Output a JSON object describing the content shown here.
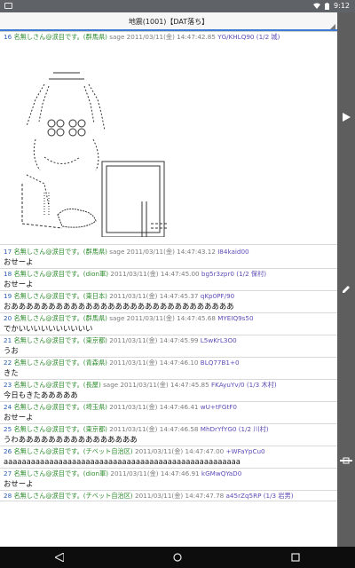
{
  "statusbar": {
    "time": "9:12"
  },
  "thread": {
    "title": "地震(1001)【DAT落ち】"
  },
  "side": {
    "next_icon": "play-arrow-icon",
    "edit_icon": "pencil-icon",
    "scroll_icon": "scroll-handle-icon"
  },
  "posts": [
    {
      "num": "16",
      "name": "名無しさん@涙目です。",
      "pref": "(群馬県)",
      "rest": " sage 2011/03/11(金) 14:47:42.85 ",
      "id": "YG/KHLQ90 (1/2 城)",
      "body": ""
    },
    {
      "num": "17",
      "name": "名無しさん@涙目です。",
      "pref": "(群馬県)",
      "rest": " sage 2011/03/11(金) 14:47:43.12 ",
      "id": "I84kaid00",
      "body": "おせーよ"
    },
    {
      "num": "18",
      "name": "名無しさん@涙目です。",
      "pref": "(dion軍)",
      "rest": " 2011/03/11(金) 14:47:45.00 ",
      "id": "bg5r3zpr0 (1/2 保村)",
      "body": "おせーよ"
    },
    {
      "num": "19",
      "name": "名無しさん@涙目です。",
      "pref": "(東日本)",
      "rest": " 2011/03/11(金) 14:47:45.37 ",
      "id": "qKp0PF/90",
      "body": "おああああああああああああああああああああああああああああああ"
    },
    {
      "num": "20",
      "name": "名無しさん@涙目です。",
      "pref": "(群馬県)",
      "rest": " sage 2011/03/11(金) 14:47:45.68 ",
      "id": "MYEIQ9s50",
      "body": "でかいいいいいいいいいい"
    },
    {
      "num": "21",
      "name": "名無しさん@涙目です。",
      "pref": "(東京都)",
      "rest": " 2011/03/11(金) 14:47:45.99 ",
      "id": "L5wKrL3O0",
      "body": "うお"
    },
    {
      "num": "22",
      "name": "名無しさん@涙目です。",
      "pref": "(青森県)",
      "rest": " 2011/03/11(金) 14:47:46.10 ",
      "id": "BLQ77B1+0",
      "body": "きた"
    },
    {
      "num": "23",
      "name": "名無しさん@涙目です。",
      "pref": "(長屋)",
      "rest": " sage 2011/03/11(金) 14:47:45.85 ",
      "id": "FKAyuYv/0 (1/3 木村)",
      "body": "今日もきたあああああ"
    },
    {
      "num": "24",
      "name": "名無しさん@涙目です。",
      "pref": "(埼玉県)",
      "rest": " 2011/03/11(金) 14:47:46.41 ",
      "id": "wU+tFGtF0",
      "body": "おせーよ"
    },
    {
      "num": "25",
      "name": "名無しさん@涙目です。",
      "pref": "(東京都)",
      "rest": " 2011/03/11(金) 14:47:46.58 ",
      "id": "MhDrYfYG0 (1/2 川村)",
      "body": "うわああああああああああああああああ"
    },
    {
      "num": "26",
      "name": "名無しさん@涙目です。",
      "pref": "(チベット自治区)",
      "rest": " 2011/03/11(金) 14:47:47.00 ",
      "id": "+WFaYpCu0",
      "body": "aaaaaaaaaaaaaaaaaaaaaaaaaaaaaaaaaaaaaaaaaaaaaaaaaaaa"
    },
    {
      "num": "27",
      "name": "名無しさん@涙目です。",
      "pref": "(dion軍)",
      "rest": " 2011/03/11(金) 14:47:46.91 ",
      "id": "kGMwQYaD0",
      "body": "おせーよ"
    },
    {
      "num": "28",
      "name": "名無しさん@涙目です。",
      "pref": "(チベット自治区)",
      "rest": " 2011/03/11(金) 14:47:47.78 ",
      "id": "a45rZq5RP (1/3 岩男)",
      "body": ""
    }
  ]
}
